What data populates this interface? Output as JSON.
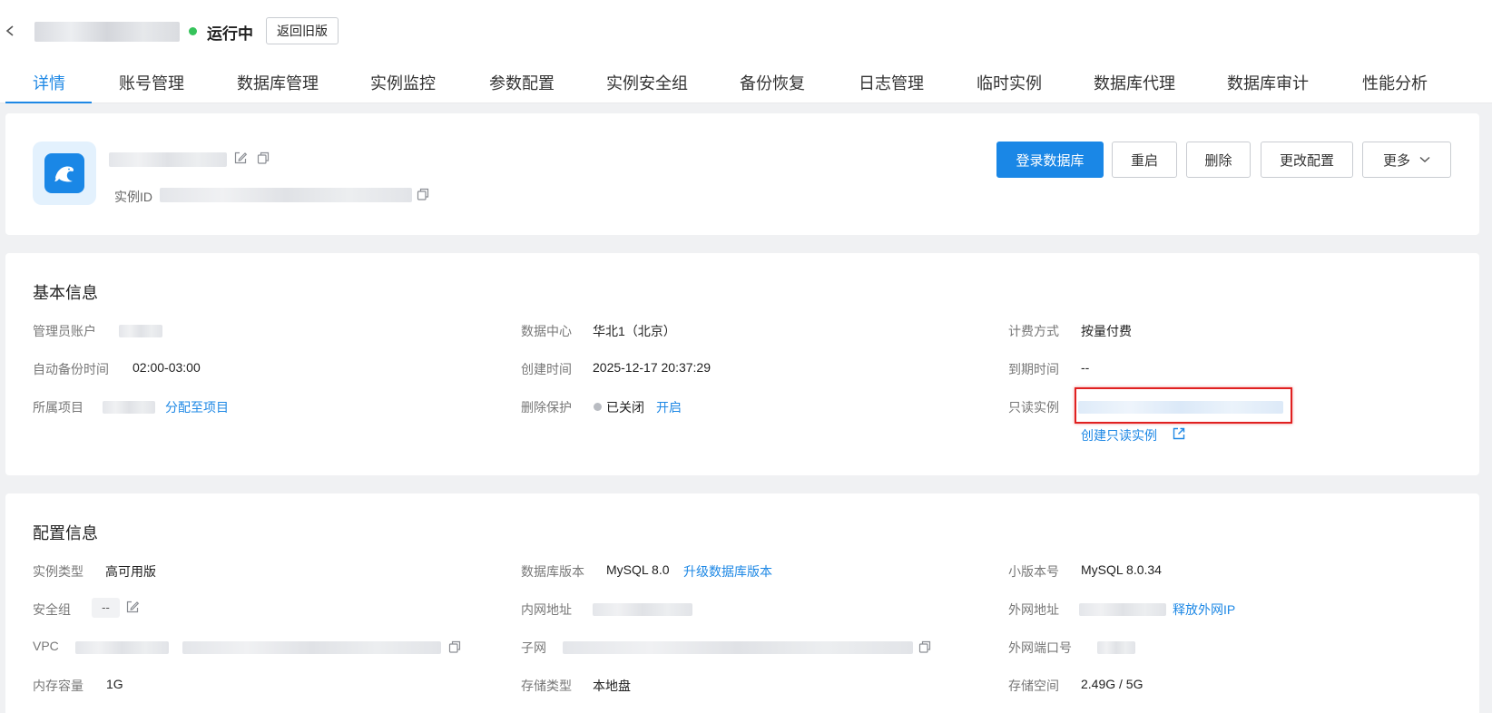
{
  "header": {
    "status_text": "运行中",
    "back_old_label": "返回旧版",
    "status_color": "#36c35b"
  },
  "tabs": [
    {
      "label": "详情"
    },
    {
      "label": "账号管理"
    },
    {
      "label": "数据库管理"
    },
    {
      "label": "实例监控"
    },
    {
      "label": "参数配置"
    },
    {
      "label": "实例安全组"
    },
    {
      "label": "备份恢复"
    },
    {
      "label": "日志管理"
    },
    {
      "label": "临时实例"
    },
    {
      "label": "数据库代理"
    },
    {
      "label": "数据库审计"
    },
    {
      "label": "性能分析"
    }
  ],
  "instance": {
    "id_label": "实例ID"
  },
  "actions": {
    "login": "登录数据库",
    "restart": "重启",
    "delete": "删除",
    "change_config": "更改配置",
    "more": "更多"
  },
  "basic": {
    "title": "基本信息",
    "admin_label": "管理员账户",
    "backup_label": "自动备份时间",
    "backup_value": "02:00-03:00",
    "project_label": "所属项目",
    "assign_project_link": "分配至项目",
    "datacenter_label": "数据中心",
    "datacenter_value": "华北1（北京）",
    "created_label": "创建时间",
    "created_value": "2025-12-17 20:37:29",
    "delete_protect_label": "删除保护",
    "delete_protect_value": "已关闭",
    "delete_protect_enable": "开启",
    "billing_label": "计费方式",
    "billing_value": "按量付费",
    "expire_label": "到期时间",
    "expire_value": "--",
    "readonly_label": "只读实例",
    "create_readonly_link": "创建只读实例"
  },
  "config": {
    "title": "配置信息",
    "type_label": "实例类型",
    "type_value": "高可用版",
    "sg_label": "安全组",
    "sg_value": "--",
    "vpc_label": "VPC",
    "memory_label": "内存容量",
    "memory_value": "1G",
    "dbver_label": "数据库版本",
    "dbver_value": "MySQL 8.0",
    "upgrade_link": "升级数据库版本",
    "intranet_label": "内网地址",
    "subnet_label": "子网",
    "storage_type_label": "存储类型",
    "storage_type_value": "本地盘",
    "minor_label": "小版本号",
    "minor_value": "MySQL 8.0.34",
    "public_label": "外网地址",
    "release_ip_link": "释放外网IP",
    "public_port_label": "外网端口号",
    "storage_space_label": "存储空间",
    "storage_space_value": "2.49G / 5G"
  },
  "colors": {
    "accent": "#1e88e5",
    "primary_button": "#1a87e6",
    "highlight_box": "#e02020"
  }
}
